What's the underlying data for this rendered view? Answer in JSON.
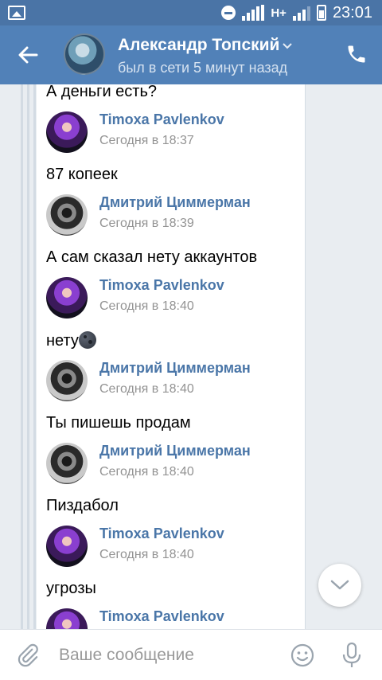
{
  "status_bar": {
    "time": "23:01",
    "network": "H+",
    "icons": [
      "image-icon",
      "do-not-disturb-icon",
      "signal-icon",
      "battery-icon"
    ]
  },
  "header": {
    "title": "Александр Топский",
    "status": "был в сети 5 минут назад",
    "back_icon": "arrow-left-icon",
    "call_icon": "phone-icon",
    "accent": "#5181b8"
  },
  "chat": {
    "items": [
      {
        "type": "text",
        "text": "А деньги есть?"
      },
      {
        "type": "sender",
        "name": "Timoxa Pavlenkov",
        "time": "Сегодня в 18:37"
      },
      {
        "type": "text",
        "text": "87 копеек"
      },
      {
        "type": "sender",
        "name": "Дмитрий Циммерман",
        "time": "Сегодня в 18:39"
      },
      {
        "type": "text",
        "text": "А сам сказал нету аккаунтов"
      },
      {
        "type": "sender",
        "name": "Timoxa Pavlenkov",
        "time": "Сегодня в 18:40"
      },
      {
        "type": "text",
        "text": "нету",
        "emoji": "new-moon-face-emoji"
      },
      {
        "type": "sender",
        "name": "Дмитрий Циммерман",
        "time": "Сегодня в 18:40"
      },
      {
        "type": "text",
        "text": "Ты пишешь продам"
      },
      {
        "type": "sender",
        "name": "Дмитрий Циммерман",
        "time": "Сегодня в 18:40"
      },
      {
        "type": "text",
        "text": "Пиздабол"
      },
      {
        "type": "sender",
        "name": "Timoxa Pavlenkov",
        "time": "Сегодня в 18:40"
      },
      {
        "type": "text",
        "text": "угрозы"
      },
      {
        "type": "sender",
        "name": "Timoxa Pavlenkov",
        "time": ""
      }
    ],
    "name_color": "#4a76a8",
    "time_color": "#939393"
  },
  "composer": {
    "placeholder": "Ваше сообщение",
    "value": "",
    "attach_icon": "paperclip-icon",
    "sticker_icon": "smiley-icon",
    "mic_icon": "microphone-icon"
  }
}
